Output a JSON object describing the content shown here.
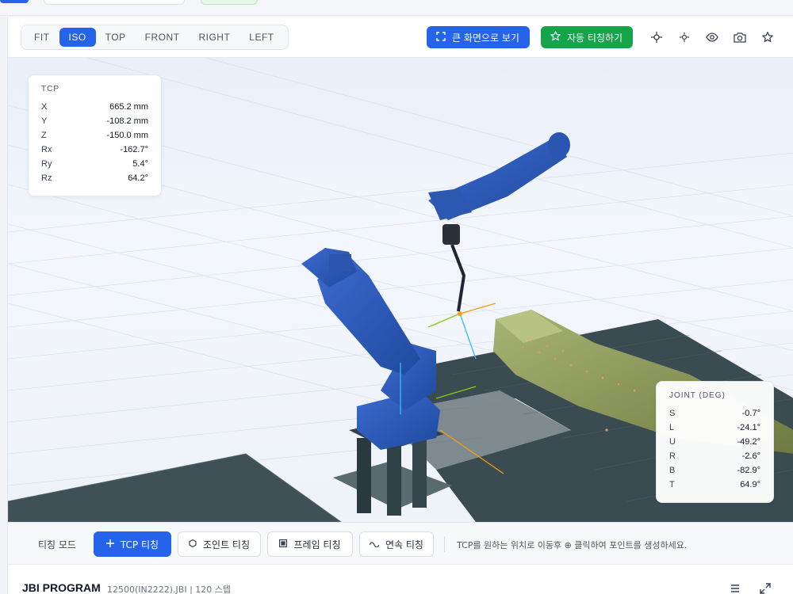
{
  "toolbar": {
    "views": [
      {
        "label": "FIT",
        "active": false
      },
      {
        "label": "ISO",
        "active": true
      },
      {
        "label": "TOP",
        "active": false
      },
      {
        "label": "FRONT",
        "active": false
      },
      {
        "label": "RIGHT",
        "active": false
      },
      {
        "label": "LEFT",
        "active": false
      }
    ],
    "fullscreen_label": "큰 화면으로 보기",
    "auto_teach_label": "자동 티칭하기",
    "icons": [
      "crosshair-icon",
      "target-icon",
      "eye-icon",
      "camera-icon",
      "star-icon"
    ]
  },
  "tcp": {
    "title": "TCP",
    "rows": [
      {
        "k": "X",
        "v": "665.2 mm"
      },
      {
        "k": "Y",
        "v": "-108.2 mm"
      },
      {
        "k": "Z",
        "v": "-150.0 mm"
      },
      {
        "k": "Rx",
        "v": "-162.7°"
      },
      {
        "k": "Ry",
        "v": "5.4°"
      },
      {
        "k": "Rz",
        "v": "64.2°"
      }
    ]
  },
  "joint": {
    "title": "JOINT (DEG)",
    "rows": [
      {
        "k": "S",
        "v": "-0.7°"
      },
      {
        "k": "L",
        "v": "-24.1°"
      },
      {
        "k": "U",
        "v": "-49.2°"
      },
      {
        "k": "R",
        "v": "-2.6°"
      },
      {
        "k": "B",
        "v": "-82.9°"
      },
      {
        "k": "T",
        "v": "64.9°"
      }
    ]
  },
  "modebar": {
    "label": "티칭 모드",
    "buttons": [
      {
        "label": "TCP 티칭",
        "active": true
      },
      {
        "label": "조인트 티칭",
        "active": false
      },
      {
        "label": "프레임 티칭",
        "active": false
      },
      {
        "label": "연속 티칭",
        "active": false
      }
    ],
    "hint": "TCP를 원하는 위치로 이동후 ⊕ 클릭하여 포인트를 생성하세요."
  },
  "program": {
    "title": "JBI PROGRAM",
    "subtitle": "12500(IN2222).JBI | 120 스텝"
  },
  "colors": {
    "accent": "#2563eb",
    "success": "#16a34a",
    "robot": "#2f5bb8",
    "workpiece": "#8d9a5a",
    "table": "#3f5157"
  }
}
